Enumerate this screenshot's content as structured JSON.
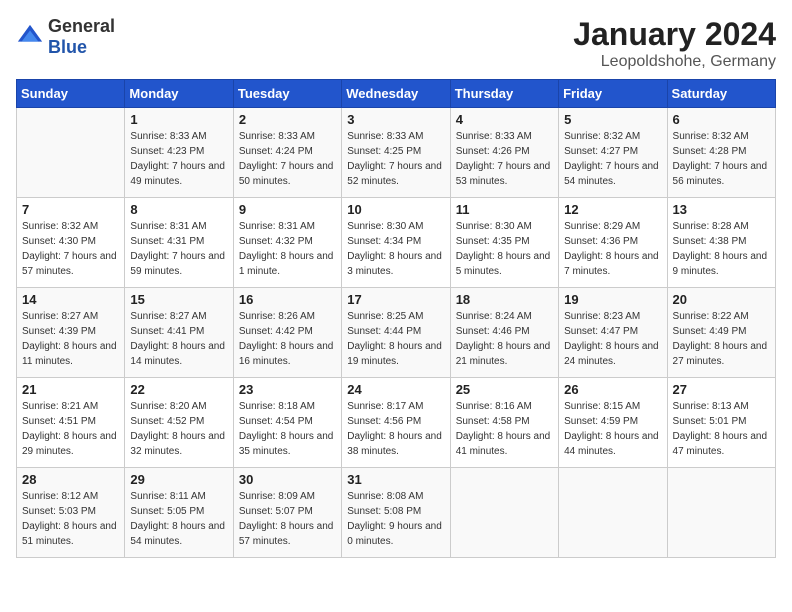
{
  "logo": {
    "general": "General",
    "blue": "Blue"
  },
  "header": {
    "month": "January 2024",
    "location": "Leopoldshohe, Germany"
  },
  "weekdays": [
    "Sunday",
    "Monday",
    "Tuesday",
    "Wednesday",
    "Thursday",
    "Friday",
    "Saturday"
  ],
  "weeks": [
    [
      {
        "day": "",
        "sunrise": "",
        "sunset": "",
        "daylight": ""
      },
      {
        "day": "1",
        "sunrise": "Sunrise: 8:33 AM",
        "sunset": "Sunset: 4:23 PM",
        "daylight": "Daylight: 7 hours and 49 minutes."
      },
      {
        "day": "2",
        "sunrise": "Sunrise: 8:33 AM",
        "sunset": "Sunset: 4:24 PM",
        "daylight": "Daylight: 7 hours and 50 minutes."
      },
      {
        "day": "3",
        "sunrise": "Sunrise: 8:33 AM",
        "sunset": "Sunset: 4:25 PM",
        "daylight": "Daylight: 7 hours and 52 minutes."
      },
      {
        "day": "4",
        "sunrise": "Sunrise: 8:33 AM",
        "sunset": "Sunset: 4:26 PM",
        "daylight": "Daylight: 7 hours and 53 minutes."
      },
      {
        "day": "5",
        "sunrise": "Sunrise: 8:32 AM",
        "sunset": "Sunset: 4:27 PM",
        "daylight": "Daylight: 7 hours and 54 minutes."
      },
      {
        "day": "6",
        "sunrise": "Sunrise: 8:32 AM",
        "sunset": "Sunset: 4:28 PM",
        "daylight": "Daylight: 7 hours and 56 minutes."
      }
    ],
    [
      {
        "day": "7",
        "sunrise": "Sunrise: 8:32 AM",
        "sunset": "Sunset: 4:30 PM",
        "daylight": "Daylight: 7 hours and 57 minutes."
      },
      {
        "day": "8",
        "sunrise": "Sunrise: 8:31 AM",
        "sunset": "Sunset: 4:31 PM",
        "daylight": "Daylight: 7 hours and 59 minutes."
      },
      {
        "day": "9",
        "sunrise": "Sunrise: 8:31 AM",
        "sunset": "Sunset: 4:32 PM",
        "daylight": "Daylight: 8 hours and 1 minute."
      },
      {
        "day": "10",
        "sunrise": "Sunrise: 8:30 AM",
        "sunset": "Sunset: 4:34 PM",
        "daylight": "Daylight: 8 hours and 3 minutes."
      },
      {
        "day": "11",
        "sunrise": "Sunrise: 8:30 AM",
        "sunset": "Sunset: 4:35 PM",
        "daylight": "Daylight: 8 hours and 5 minutes."
      },
      {
        "day": "12",
        "sunrise": "Sunrise: 8:29 AM",
        "sunset": "Sunset: 4:36 PM",
        "daylight": "Daylight: 8 hours and 7 minutes."
      },
      {
        "day": "13",
        "sunrise": "Sunrise: 8:28 AM",
        "sunset": "Sunset: 4:38 PM",
        "daylight": "Daylight: 8 hours and 9 minutes."
      }
    ],
    [
      {
        "day": "14",
        "sunrise": "Sunrise: 8:27 AM",
        "sunset": "Sunset: 4:39 PM",
        "daylight": "Daylight: 8 hours and 11 minutes."
      },
      {
        "day": "15",
        "sunrise": "Sunrise: 8:27 AM",
        "sunset": "Sunset: 4:41 PM",
        "daylight": "Daylight: 8 hours and 14 minutes."
      },
      {
        "day": "16",
        "sunrise": "Sunrise: 8:26 AM",
        "sunset": "Sunset: 4:42 PM",
        "daylight": "Daylight: 8 hours and 16 minutes."
      },
      {
        "day": "17",
        "sunrise": "Sunrise: 8:25 AM",
        "sunset": "Sunset: 4:44 PM",
        "daylight": "Daylight: 8 hours and 19 minutes."
      },
      {
        "day": "18",
        "sunrise": "Sunrise: 8:24 AM",
        "sunset": "Sunset: 4:46 PM",
        "daylight": "Daylight: 8 hours and 21 minutes."
      },
      {
        "day": "19",
        "sunrise": "Sunrise: 8:23 AM",
        "sunset": "Sunset: 4:47 PM",
        "daylight": "Daylight: 8 hours and 24 minutes."
      },
      {
        "day": "20",
        "sunrise": "Sunrise: 8:22 AM",
        "sunset": "Sunset: 4:49 PM",
        "daylight": "Daylight: 8 hours and 27 minutes."
      }
    ],
    [
      {
        "day": "21",
        "sunrise": "Sunrise: 8:21 AM",
        "sunset": "Sunset: 4:51 PM",
        "daylight": "Daylight: 8 hours and 29 minutes."
      },
      {
        "day": "22",
        "sunrise": "Sunrise: 8:20 AM",
        "sunset": "Sunset: 4:52 PM",
        "daylight": "Daylight: 8 hours and 32 minutes."
      },
      {
        "day": "23",
        "sunrise": "Sunrise: 8:18 AM",
        "sunset": "Sunset: 4:54 PM",
        "daylight": "Daylight: 8 hours and 35 minutes."
      },
      {
        "day": "24",
        "sunrise": "Sunrise: 8:17 AM",
        "sunset": "Sunset: 4:56 PM",
        "daylight": "Daylight: 8 hours and 38 minutes."
      },
      {
        "day": "25",
        "sunrise": "Sunrise: 8:16 AM",
        "sunset": "Sunset: 4:58 PM",
        "daylight": "Daylight: 8 hours and 41 minutes."
      },
      {
        "day": "26",
        "sunrise": "Sunrise: 8:15 AM",
        "sunset": "Sunset: 4:59 PM",
        "daylight": "Daylight: 8 hours and 44 minutes."
      },
      {
        "day": "27",
        "sunrise": "Sunrise: 8:13 AM",
        "sunset": "Sunset: 5:01 PM",
        "daylight": "Daylight: 8 hours and 47 minutes."
      }
    ],
    [
      {
        "day": "28",
        "sunrise": "Sunrise: 8:12 AM",
        "sunset": "Sunset: 5:03 PM",
        "daylight": "Daylight: 8 hours and 51 minutes."
      },
      {
        "day": "29",
        "sunrise": "Sunrise: 8:11 AM",
        "sunset": "Sunset: 5:05 PM",
        "daylight": "Daylight: 8 hours and 54 minutes."
      },
      {
        "day": "30",
        "sunrise": "Sunrise: 8:09 AM",
        "sunset": "Sunset: 5:07 PM",
        "daylight": "Daylight: 8 hours and 57 minutes."
      },
      {
        "day": "31",
        "sunrise": "Sunrise: 8:08 AM",
        "sunset": "Sunset: 5:08 PM",
        "daylight": "Daylight: 9 hours and 0 minutes."
      },
      {
        "day": "",
        "sunrise": "",
        "sunset": "",
        "daylight": ""
      },
      {
        "day": "",
        "sunrise": "",
        "sunset": "",
        "daylight": ""
      },
      {
        "day": "",
        "sunrise": "",
        "sunset": "",
        "daylight": ""
      }
    ]
  ]
}
